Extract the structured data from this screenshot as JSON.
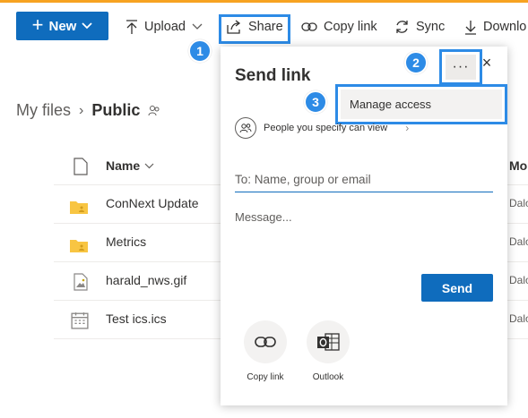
{
  "toolbar": {
    "new_label": "New",
    "upload_label": "Upload",
    "share_label": "Share",
    "copy_link_label": "Copy link",
    "sync_label": "Sync",
    "download_label": "Downlo"
  },
  "callouts": [
    "1",
    "2",
    "3"
  ],
  "breadcrumb": {
    "root": "My files",
    "current": "Public"
  },
  "list": {
    "header_name": "Name",
    "header_modified": "Mo",
    "rows": [
      {
        "name": "ConNext Update",
        "type": "folder",
        "modified": "Dalo"
      },
      {
        "name": "Metrics",
        "type": "folder",
        "modified": "Dalo"
      },
      {
        "name": "harald_nws.gif",
        "type": "image",
        "modified": "Dalo"
      },
      {
        "name": "Test ics.ics",
        "type": "calendar",
        "modified": "Dalo"
      }
    ]
  },
  "panel": {
    "title": "Send link",
    "more_label": "···",
    "close_label": "×",
    "menu_item": "Manage access",
    "permission_text": "People you specify can view",
    "to_placeholder": "To: Name, group or email",
    "message_placeholder": "Message...",
    "send_label": "Send",
    "share_options": [
      {
        "label": "Copy link",
        "icon": "link-icon"
      },
      {
        "label": "Outlook",
        "icon": "outlook-icon"
      }
    ]
  },
  "colors": {
    "accent": "#0f6cbd",
    "highlight": "#2d8be6",
    "top_strip": "#f7a321",
    "folder": "#f8c542"
  }
}
